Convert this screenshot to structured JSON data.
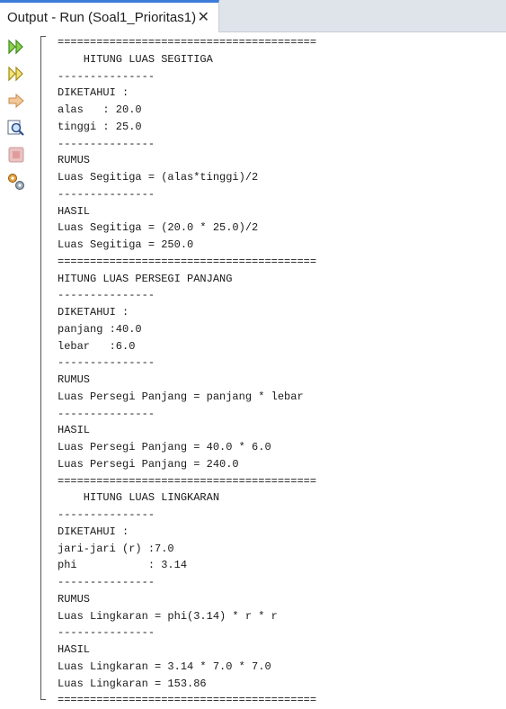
{
  "tab": {
    "title": "Output - Run (Soal1_Prioritas1)",
    "close_glyph": "✕"
  },
  "toolbar": {
    "icons": [
      "rerun-icon",
      "rerun-with-options-icon",
      "step-icon",
      "find-icon",
      "stop-icon",
      "settings-icon"
    ]
  },
  "output_lines": [
    "========================================",
    "    HITUNG LUAS SEGITIGA",
    "---------------",
    "DIKETAHUI :",
    "alas   : 20.0",
    "tinggi : 25.0",
    "---------------",
    "RUMUS",
    "Luas Segitiga = (alas*tinggi)/2",
    "---------------",
    "HASIL",
    "Luas Segitiga = (20.0 * 25.0)/2",
    "Luas Segitiga = 250.0",
    "========================================",
    "HITUNG LUAS PERSEGI PANJANG",
    "---------------",
    "DIKETAHUI :",
    "panjang :40.0",
    "lebar   :6.0",
    "---------------",
    "RUMUS",
    "Luas Persegi Panjang = panjang * lebar",
    "---------------",
    "HASIL",
    "Luas Persegi Panjang = 40.0 * 6.0",
    "Luas Persegi Panjang = 240.0",
    "========================================",
    "    HITUNG LUAS LINGKARAN",
    "---------------",
    "DIKETAHUI :",
    "jari-jari (r) :7.0",
    "phi           : 3.14",
    "---------------",
    "RUMUS",
    "Luas Lingkaran = phi(3.14) * r * r",
    "---------------",
    "HASIL",
    "Luas Lingkaran = 3.14 * 7.0 * 7.0",
    "Luas Lingkaran = 153.86",
    "========================================"
  ]
}
